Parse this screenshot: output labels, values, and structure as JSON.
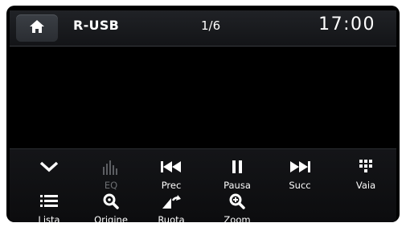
{
  "header": {
    "source": "R-USB",
    "track_position": "1/6",
    "clock": "17:00"
  },
  "controls": {
    "row1": [
      {
        "label": "",
        "icon": "chevron-down-icon"
      },
      {
        "label": "EQ",
        "icon": "equalizer-icon",
        "enabled": false
      },
      {
        "label": "Prec",
        "icon": "previous-track-icon"
      },
      {
        "label": "Pausa",
        "icon": "pause-icon"
      },
      {
        "label": "Succ",
        "icon": "next-track-icon"
      },
      {
        "label": "Vaia",
        "icon": "keypad-icon"
      }
    ],
    "row2": [
      {
        "label": "Lista",
        "icon": "list-icon"
      },
      {
        "label": "Origine",
        "icon": "magnifier-icon"
      },
      {
        "label": "Ruota",
        "icon": "rotate-icon"
      },
      {
        "label": "Zoom",
        "icon": "zoom-in-icon"
      }
    ]
  },
  "colors": {
    "background": "#000000",
    "text": "#ffffff",
    "disabled_text": "#6d6f73"
  }
}
